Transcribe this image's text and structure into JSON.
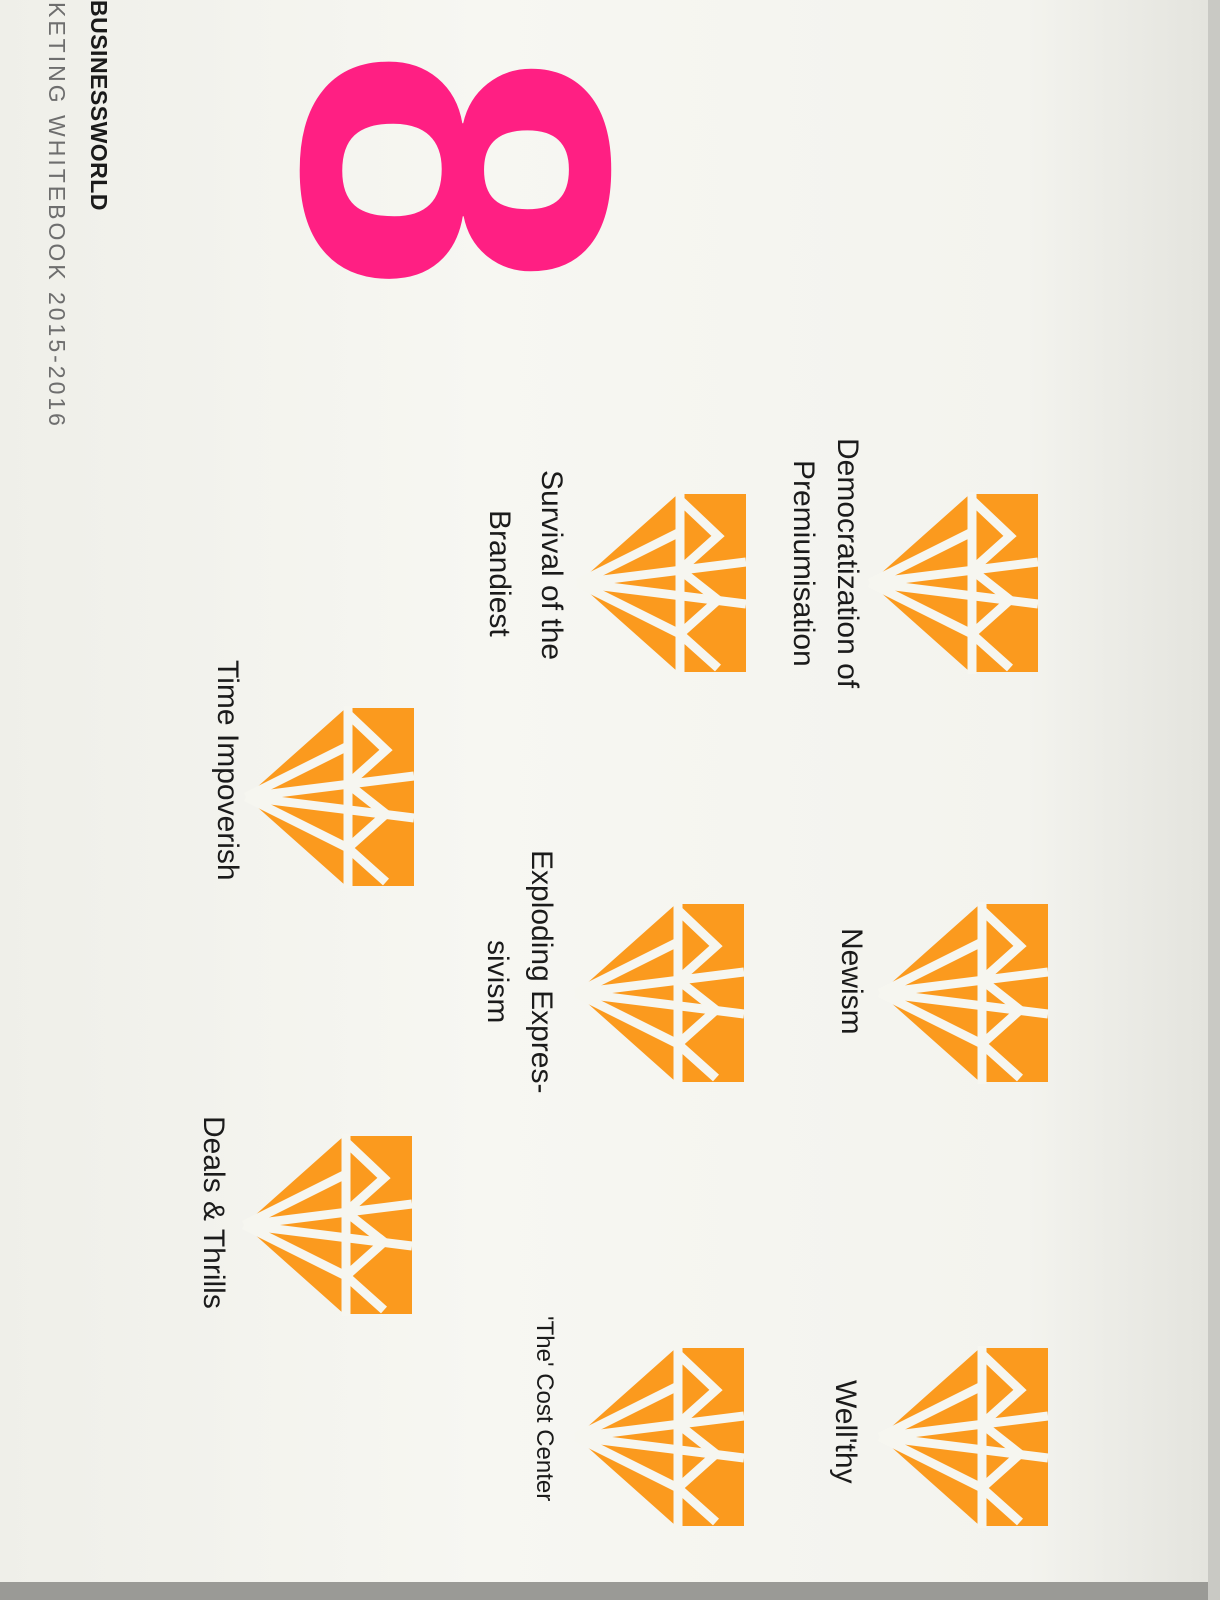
{
  "masthead": {
    "brand": "BUSINESSWORLD",
    "publication": "KETING WHITEBOOK 2015-2016"
  },
  "headline_number": "8",
  "trends": [
    {
      "line1": "Democratization of",
      "line2": "Premiumisation"
    },
    {
      "line1": "Survival of the",
      "line2": "Brandiest"
    },
    {
      "line1": "Time Impoverish",
      "line2": ""
    },
    {
      "line1": "Newism",
      "line2": ""
    },
    {
      "line1": "Exploding Expres-",
      "line2": "sivism"
    },
    {
      "line1": "Deals & Thrills",
      "line2": ""
    },
    {
      "line1": "Well'thy",
      "line2": ""
    },
    {
      "line1": "'The' Cost Center",
      "line2": ""
    }
  ],
  "colors": {
    "accent_pink": "#ff1f83",
    "diamond_orange": "#fb9a1e",
    "text": "#1b1b1b"
  },
  "icons": {
    "trend_marker": "diamond-icon"
  }
}
